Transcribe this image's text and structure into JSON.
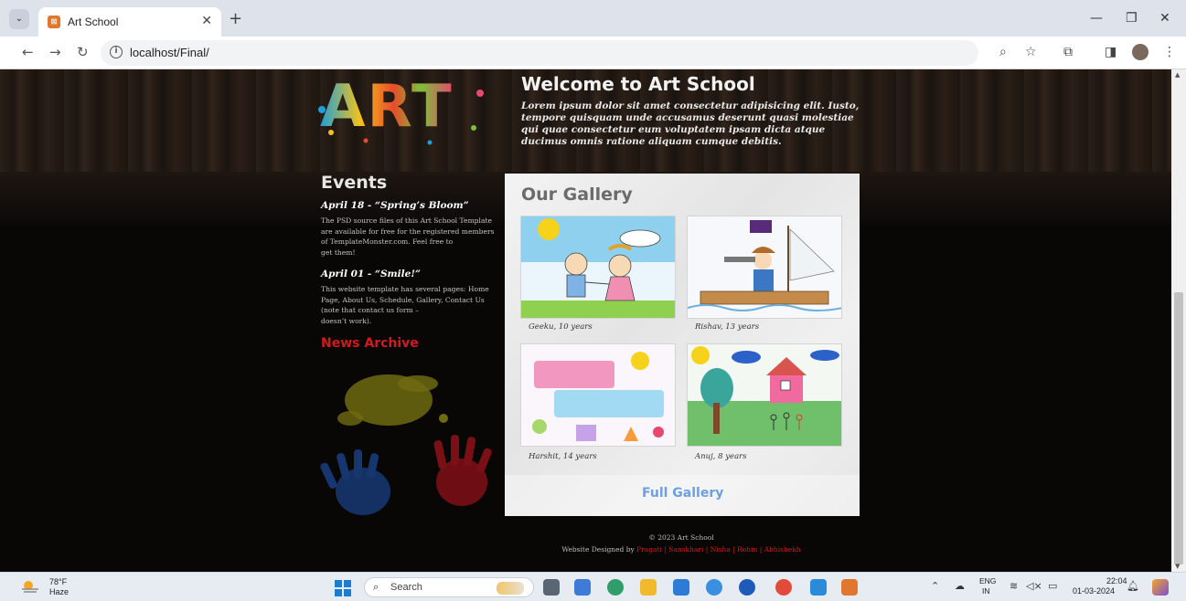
{
  "browser": {
    "tab_title": "Art School",
    "url": "localhost/Final/"
  },
  "page": {
    "logo_text": "ART",
    "welcome_title": "Welcome to Art School",
    "welcome_text": "Lorem ipsum dolor sit amet consectetur adipisicing elit. Iusto, tempore quisquam unde accusamus deserunt quasi molestiae qui quae consectetur eum voluptatem ipsam dicta atque ducimus omnis ratione aliquam cumque debitis.",
    "events_title": "Events",
    "events": [
      {
        "heading": "April 18 - “Spring’s Bloom”",
        "body": "The PSD source files of this Art School Template\nare available for free for the registered members\nof TemplateMonster.com. Feel free to\nget them!"
      },
      {
        "heading": "April 01 - “Smile!”",
        "body": "This website template has several pages: Home\nPage, About Us, Schedule, Gallery, Contact Us\n(note that contact us form –\ndoesn’t work)."
      }
    ],
    "news_archive": "News Archive",
    "gallery_title": "Our Gallery",
    "gallery": [
      {
        "caption": "Geeku, 10 years"
      },
      {
        "caption": "Rishav, 13 years"
      },
      {
        "caption": "Harshit, 14 years"
      },
      {
        "caption": "Anuj, 8 years"
      }
    ],
    "full_gallery": "Full Gallery",
    "copyright": "© 2023 Art School",
    "designed_by": "Website Designed by",
    "designers": [
      "Pragati",
      "Sanskhari",
      "Nisha",
      "Rohin",
      "Abhishekh"
    ]
  },
  "taskbar": {
    "temperature": "78°F",
    "weather": "Haze",
    "search_placeholder": "Search",
    "lang_line1": "ENG",
    "lang_line2": "IN",
    "time": "22:04",
    "date": "01-03-2024"
  },
  "colors": {
    "accent_red": "#d11b1b",
    "link_blue": "#6e9fe0",
    "gallery_bg": "#ececec"
  }
}
